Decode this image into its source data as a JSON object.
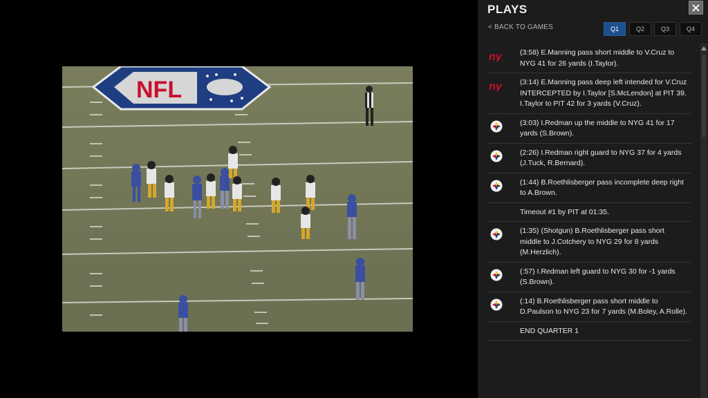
{
  "panel": {
    "title": "PLAYS",
    "back_label": "< BACK TO GAMES",
    "quarters": [
      "Q1",
      "Q2",
      "Q3",
      "Q4"
    ],
    "active_quarter": "Q1"
  },
  "video": {
    "field_logo_text": "NFL"
  },
  "plays": [
    {
      "team": "nyg",
      "icon": "giants-logo-icon",
      "text": "(3:58) E.Manning pass short middle to V.Cruz to NYG 41 for 26 yards (I.Taylor)."
    },
    {
      "team": "nyg",
      "icon": "giants-logo-icon",
      "text": "(3:14) E.Manning pass deep left intended for V.Cruz INTERCEPTED by I.Taylor [S.McLendon] at PIT 39. I.Taylor to PIT 42 for 3 yards (V.Cruz)."
    },
    {
      "team": "pit",
      "icon": "steelers-logo-icon",
      "text": "(3:03) I.Redman up the middle to NYG 41 for 17 yards (S.Brown)."
    },
    {
      "team": "pit",
      "icon": "steelers-logo-icon",
      "text": "(2:26) I.Redman right guard to NYG 37 for 4 yards (J.Tuck, R.Bernard)."
    },
    {
      "team": "pit",
      "icon": "steelers-logo-icon",
      "text": "(1:44) B.Roethlisberger pass incomplete deep right to A.Brown."
    },
    {
      "team": "",
      "icon": "",
      "text": "Timeout #1 by PIT at 01:35."
    },
    {
      "team": "pit",
      "icon": "steelers-logo-icon",
      "text": "(1:35) (Shotgun) B.Roethlisberger pass short middle to J.Cotchery to NYG 29 for 8 yards (M.Herzlich)."
    },
    {
      "team": "pit",
      "icon": "steelers-logo-icon",
      "text": "(:57) I.Redman left guard to NYG 30 for -1 yards (S.Brown)."
    },
    {
      "team": "pit",
      "icon": "steelers-logo-icon",
      "text": "(:14) B.Roethlisberger pass short middle to D.Paulson to NYG 23 for 7 yards (M.Boley, A.Rolle)."
    },
    {
      "team": "",
      "icon": "",
      "text": "END QUARTER 1"
    }
  ],
  "colors": {
    "panel_bg": "#1c1c1c",
    "active_tab": "#1c4f8f",
    "giants_red": "#c8102e",
    "steelers_gold": "#ffb612"
  }
}
